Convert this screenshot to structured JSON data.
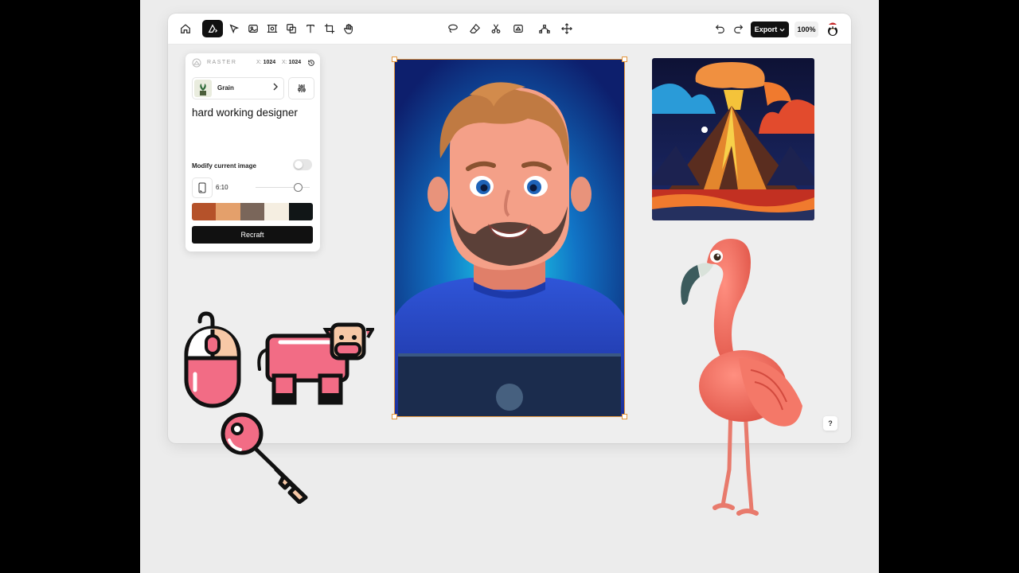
{
  "toolbar": {
    "export_label": "Export",
    "zoom": "100%",
    "left_tools": [
      "home-icon",
      "style-icon",
      "pointer-icon",
      "image-icon",
      "frame-image-icon",
      "shapes-icon",
      "text-icon",
      "crop-icon",
      "hand-icon"
    ],
    "center_tools": [
      "lasso-icon",
      "eraser-icon",
      "scissors-icon",
      "inpaint-icon",
      "vectorize-icon",
      "move-icon"
    ],
    "history": [
      "undo-icon",
      "redo-icon"
    ]
  },
  "panel": {
    "type_label": "RASTER",
    "x_label": "X:",
    "x_value": "1024",
    "y_label": "X:",
    "y_value": "1024",
    "style_name": "Grain",
    "prompt": "hard working designer",
    "modify_label": "Modify current image",
    "modify_on": false,
    "ratio": "6:10",
    "palette": [
      "#b5522a",
      "#e4a06b",
      "#7a665a",
      "#f5eee1",
      "#111617"
    ],
    "action_label": "Recraft"
  },
  "help_label": "?",
  "colors": {
    "accent_selection": "#e3953c",
    "canvas_bg": "#eeeeee",
    "sticker_pink": "#f26c85"
  },
  "canvas_images": [
    "designer-portrait",
    "volcano-illustration",
    "flamingo-3d",
    "mouse-sticker",
    "cow-sticker",
    "key-sticker"
  ]
}
